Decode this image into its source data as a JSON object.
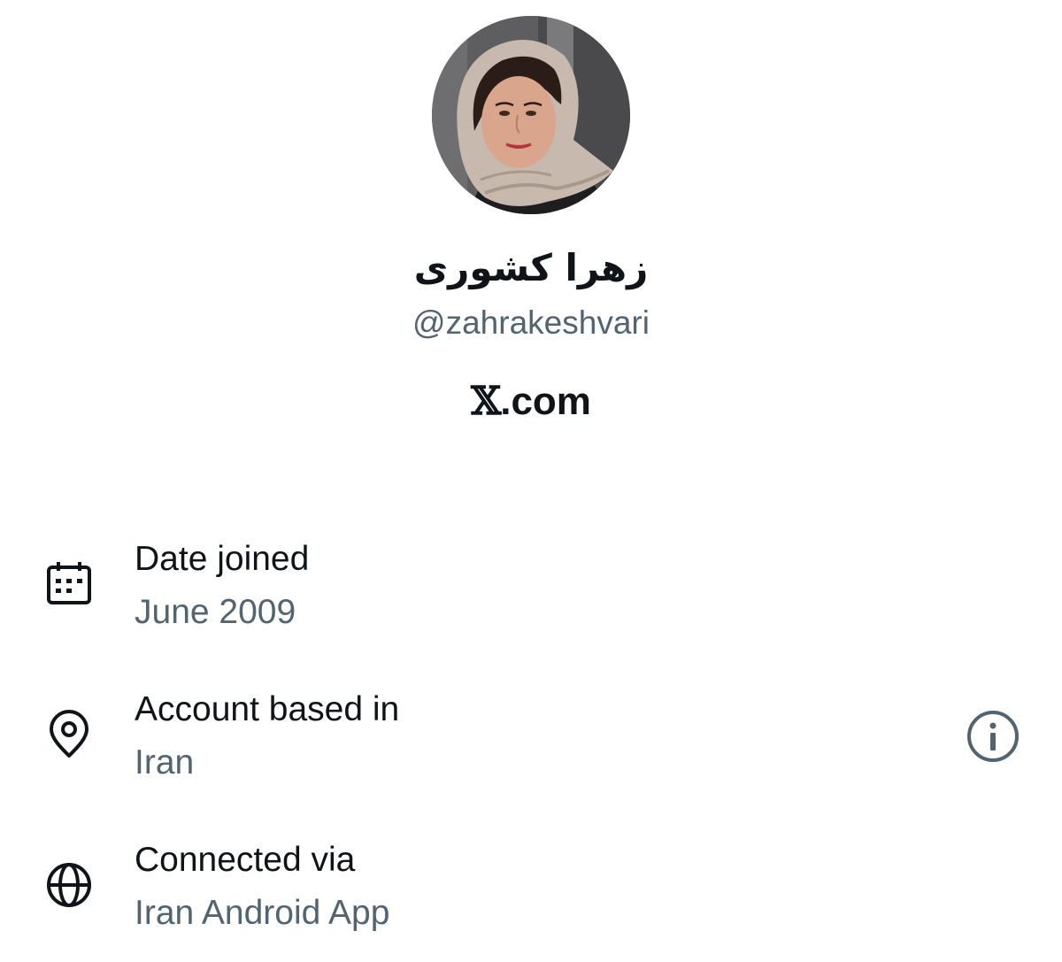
{
  "profile": {
    "display_name": "زهرا کشوری",
    "handle": "@zahrakeshvari",
    "avatar_icon": "profile-photo",
    "brand": {
      "x_glyph": "𝕏",
      "domain": ".com"
    }
  },
  "about": {
    "date_joined": {
      "icon": "calendar-icon",
      "label": "Date joined",
      "value": "June 2009"
    },
    "account_based_in": {
      "icon": "location-pin-icon",
      "label": "Account based in",
      "value": "Iran",
      "info_icon": "info-icon"
    },
    "connected_via": {
      "icon": "globe-icon",
      "label": "Connected via",
      "value": "Iran Android App"
    }
  },
  "colors": {
    "primary_text": "#0f1419",
    "secondary_text": "#536471",
    "background": "#ffffff"
  }
}
